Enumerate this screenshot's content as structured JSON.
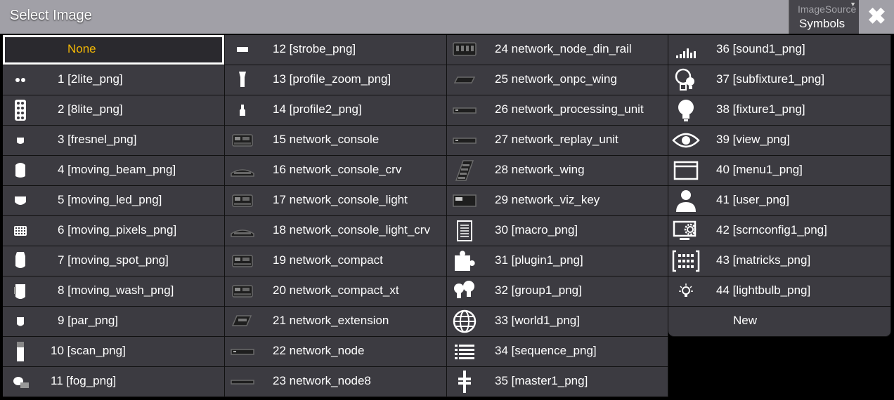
{
  "window": {
    "title": "Select Image",
    "image_source_caption": "ImageSource",
    "image_source_value": "Symbols",
    "close_glyph": "✖"
  },
  "columns": [
    [
      {
        "label": "None",
        "icon": "",
        "selected": true
      },
      {
        "label": "1 [2lite_png]",
        "icon": "2lite-icon"
      },
      {
        "label": "2 [8lite_png]",
        "icon": "8lite-icon"
      },
      {
        "label": "3 [fresnel_png]",
        "icon": "fresnel-icon"
      },
      {
        "label": "4 [moving_beam_png]",
        "icon": "moving-beam-icon"
      },
      {
        "label": "5 [moving_led_png]",
        "icon": "moving-led-icon"
      },
      {
        "label": "6 [moving_pixels_png]",
        "icon": "moving-pixels-icon"
      },
      {
        "label": "7 [moving_spot_png]",
        "icon": "moving-spot-icon"
      },
      {
        "label": "8 [moving_wash_png]",
        "icon": "moving-wash-icon"
      },
      {
        "label": "9 [par_png]",
        "icon": "par-icon"
      },
      {
        "label": "10 [scan_png]",
        "icon": "scan-icon"
      },
      {
        "label": "11 [fog_png]",
        "icon": "fog-icon"
      }
    ],
    [
      {
        "label": "12 [strobe_png]",
        "icon": "strobe-icon"
      },
      {
        "label": "13 [profile_zoom_png]",
        "icon": "profile-zoom-icon"
      },
      {
        "label": "14 [profile2_png]",
        "icon": "profile2-icon"
      },
      {
        "label": "15 network_console",
        "icon": "network-console-icon"
      },
      {
        "label": "16 network_console_crv",
        "icon": "network-console-crv-icon"
      },
      {
        "label": "17 network_console_light",
        "icon": "network-console-light-icon"
      },
      {
        "label": "18 network_console_light_crv",
        "icon": "network-console-light-crv-icon"
      },
      {
        "label": "19 network_compact",
        "icon": "network-compact-icon"
      },
      {
        "label": "20 network_compact_xt",
        "icon": "network-compact-xt-icon"
      },
      {
        "label": "21 network_extension",
        "icon": "network-extension-icon"
      },
      {
        "label": "22 network_node",
        "icon": "network-node-icon"
      },
      {
        "label": "23 network_node8",
        "icon": "network-node8-icon"
      }
    ],
    [
      {
        "label": "24 network_node_din_rail",
        "icon": "network-node-din-rail-icon"
      },
      {
        "label": "25 network_onpc_wing",
        "icon": "network-onpc-wing-icon"
      },
      {
        "label": "26 network_processing_unit",
        "icon": "network-processing-unit-icon"
      },
      {
        "label": "27 network_replay_unit",
        "icon": "network-replay-unit-icon"
      },
      {
        "label": "28 network_wing",
        "icon": "network-wing-icon"
      },
      {
        "label": "29 network_viz_key",
        "icon": "network-viz-key-icon"
      },
      {
        "label": "30 [macro_png]",
        "icon": "macro-icon"
      },
      {
        "label": "31 [plugin1_png]",
        "icon": "plugin-icon"
      },
      {
        "label": "32 [group1_png]",
        "icon": "group-icon"
      },
      {
        "label": "33 [world1_png]",
        "icon": "world-icon"
      },
      {
        "label": "34 [sequence_png]",
        "icon": "sequence-icon"
      },
      {
        "label": "35 [master1_png]",
        "icon": "master-icon"
      }
    ],
    [
      {
        "label": "36 [sound1_png]",
        "icon": "sound-icon"
      },
      {
        "label": "37 [subfixture1_png]",
        "icon": "subfixture-icon"
      },
      {
        "label": "38 [fixture1_png]",
        "icon": "fixture-icon"
      },
      {
        "label": "39 [view_png]",
        "icon": "view-icon"
      },
      {
        "label": "40 [menu1_png]",
        "icon": "menu-icon"
      },
      {
        "label": "41 [user_png]",
        "icon": "user-icon"
      },
      {
        "label": "42 [scrnconfig1_png]",
        "icon": "screen-config-icon"
      },
      {
        "label": "43 [matricks_png]",
        "icon": "matricks-icon"
      },
      {
        "label": "44 [lightbulb_png]",
        "icon": "lightbulb-icon"
      },
      {
        "label": "New",
        "icon": "",
        "new": true
      }
    ]
  ]
}
